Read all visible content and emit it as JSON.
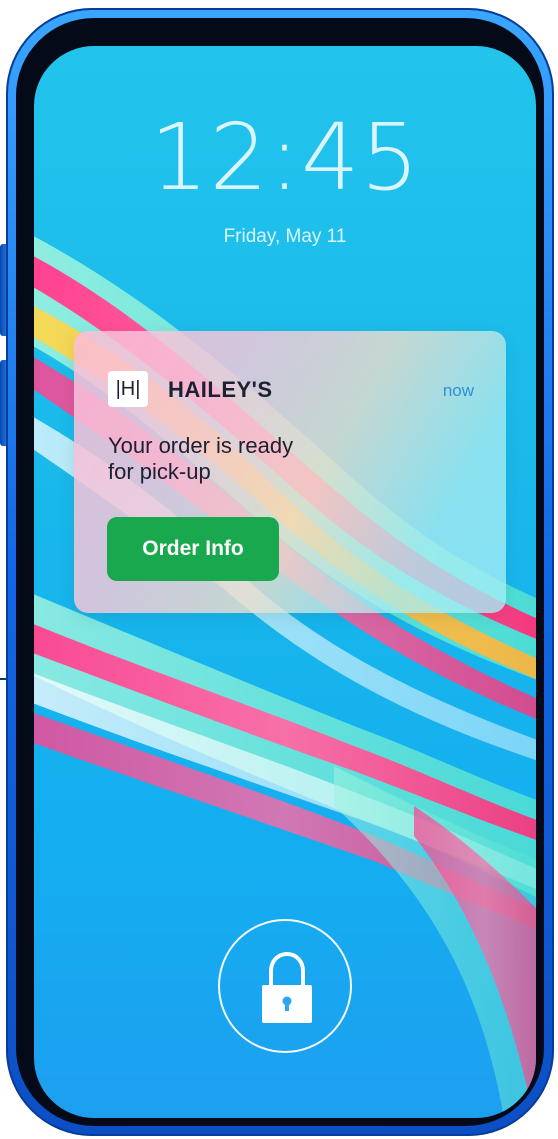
{
  "lockscreen": {
    "time": "12:45",
    "date": "Friday, May 11"
  },
  "notification": {
    "logo_text": "|H|",
    "app_name": "HAILEY'S",
    "time": "now",
    "message_line1": "Your order is ready",
    "message_line2": "for pick-up",
    "button_label": "Order Info"
  },
  "icons": {
    "unlock": "lock-icon"
  },
  "colors": {
    "button": "#1aa84e",
    "accent_time": "#2f8fd8",
    "phone_frame": "#1366e6",
    "wallpaper": "#19b9ea"
  }
}
